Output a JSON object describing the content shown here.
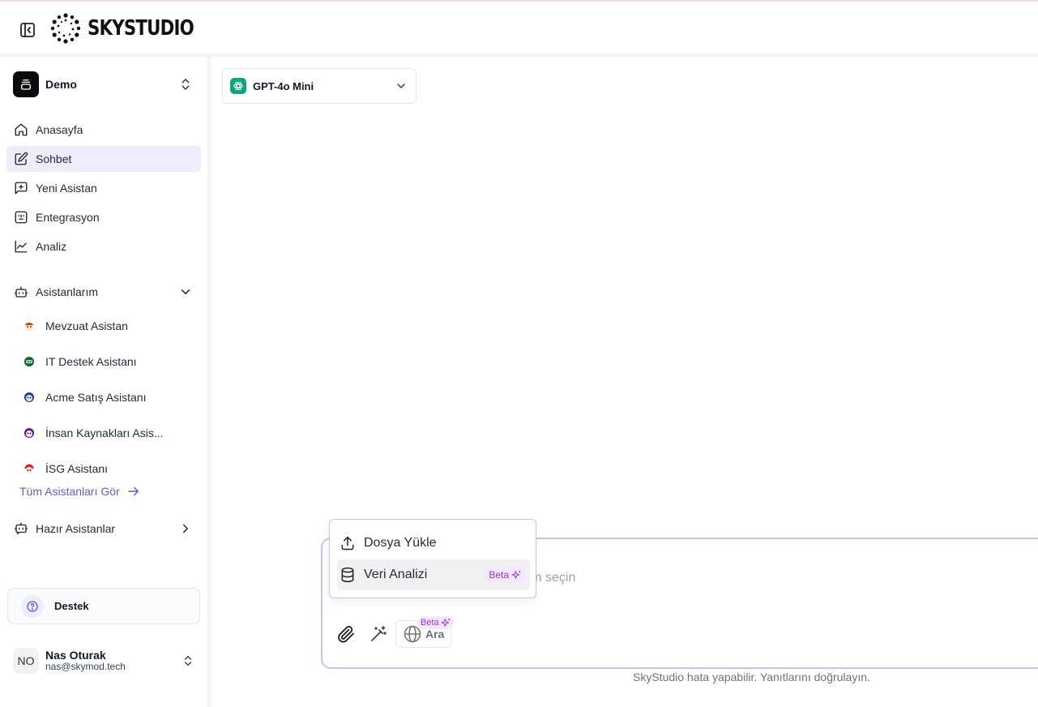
{
  "header": {
    "logo_text": "SKYSTUDIO"
  },
  "sidebar": {
    "workspace": {
      "name": "Demo"
    },
    "nav": [
      {
        "label": "Anasayfa",
        "icon": "home-icon"
      },
      {
        "label": "Sohbet",
        "icon": "edit-icon",
        "active": true
      },
      {
        "label": "Yeni Asistan",
        "icon": "message-plus-icon"
      },
      {
        "label": "Entegrasyon",
        "icon": "integration-icon"
      },
      {
        "label": "Analiz",
        "icon": "chart-line-icon"
      }
    ],
    "my_assistants": {
      "label": "Asistanlarım",
      "items": [
        {
          "label": "Mevzuat Asistan",
          "color": "#c2410c"
        },
        {
          "label": "IT Destek Asistanı",
          "color": "#15803d"
        },
        {
          "label": "Acme Satış Asistanı",
          "color": "#1d4ed8"
        },
        {
          "label": "İnsan Kaynakları Asis...",
          "color": "#9d174d"
        },
        {
          "label": "İSG Asistanı",
          "color": "#dc2626"
        }
      ],
      "see_all": "Tüm Asistanları Gör"
    },
    "ready_assistants": {
      "label": "Hazır Asistanlar"
    },
    "support": {
      "label": "Destek"
    },
    "user": {
      "initials": "NO",
      "name": "Nas Oturak",
      "email": "nas@skymod.tech"
    }
  },
  "main": {
    "model": {
      "label": "GPT-4o Mini"
    },
    "composer": {
      "placeholder": "Mesaj yazın veya / kullanarak istem seçin",
      "search_label": "Ara",
      "search_beta": "Beta"
    },
    "disclaimer": "SkyStudio hata yapabilir. Yanıtlarını doğrulayın."
  },
  "popup": {
    "items": [
      {
        "label": "Dosya Yükle",
        "icon": "upload-icon"
      },
      {
        "label": "Veri Analizi",
        "icon": "database-icon",
        "badge": "Beta"
      }
    ]
  },
  "colors": {
    "accent": "#5b5fc7",
    "active_bg": "#eceefd",
    "beta": "#9333ea",
    "model_brand": "#10a37f"
  }
}
